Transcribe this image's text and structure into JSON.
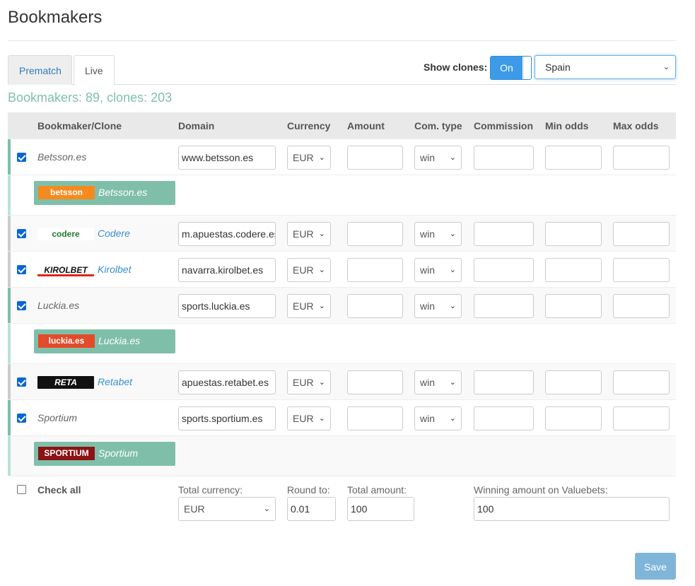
{
  "page": {
    "title": "Bookmakers"
  },
  "tabs": [
    {
      "label": "Prematch"
    },
    {
      "label": "Live"
    }
  ],
  "clones_toggle": {
    "label": "Show clones:",
    "state": "On"
  },
  "country_select": {
    "value": "Spain"
  },
  "summary": "Bookmakers: 89, clones: 203",
  "columns": [
    "Bookmaker/Clone",
    "Domain",
    "Currency",
    "Amount",
    "Com. type",
    "Commission",
    "Min odds",
    "Max odds"
  ],
  "rows": [
    {
      "name": "Betsson.es",
      "domain": "www.betsson.es",
      "currency": "EUR",
      "com_type": "win"
    },
    {
      "clone": true,
      "logo": "betsson",
      "name": "Betsson.es"
    },
    {
      "name": "Codere",
      "logo": "codere",
      "domain": "m.apuestas.codere.es",
      "currency": "EUR",
      "com_type": "win"
    },
    {
      "name": "Kirolbet",
      "logo": "KIROLBET",
      "domain": "navarra.kirolbet.es",
      "currency": "EUR",
      "com_type": "win"
    },
    {
      "name": "Luckia.es",
      "domain": "sports.luckia.es",
      "currency": "EUR",
      "com_type": "win"
    },
    {
      "clone": true,
      "logo": "luckia.es",
      "name": "Luckia.es"
    },
    {
      "name": "Retabet",
      "logo": "RETA",
      "domain": "apuestas.retabet.es",
      "currency": "EUR",
      "com_type": "win"
    },
    {
      "name": "Sportium",
      "domain": "sports.sportium.es",
      "currency": "EUR",
      "com_type": "win"
    },
    {
      "clone": true,
      "logo": "SPORTIUM",
      "name": "Sportium"
    }
  ],
  "footer": {
    "check_all": "Check all",
    "total_currency_label": "Total currency:",
    "total_currency": "EUR",
    "round_label": "Round to:",
    "round_value": "0.01",
    "total_amount_label": "Total amount:",
    "total_amount": "100",
    "winning_label": "Winning amount on Valuebets:",
    "winning_value": "100"
  },
  "save_label": "Save",
  "colors": {
    "accent": "#7fbfaa",
    "primary": "#3c9ae8",
    "link": "#3a8fd0"
  }
}
